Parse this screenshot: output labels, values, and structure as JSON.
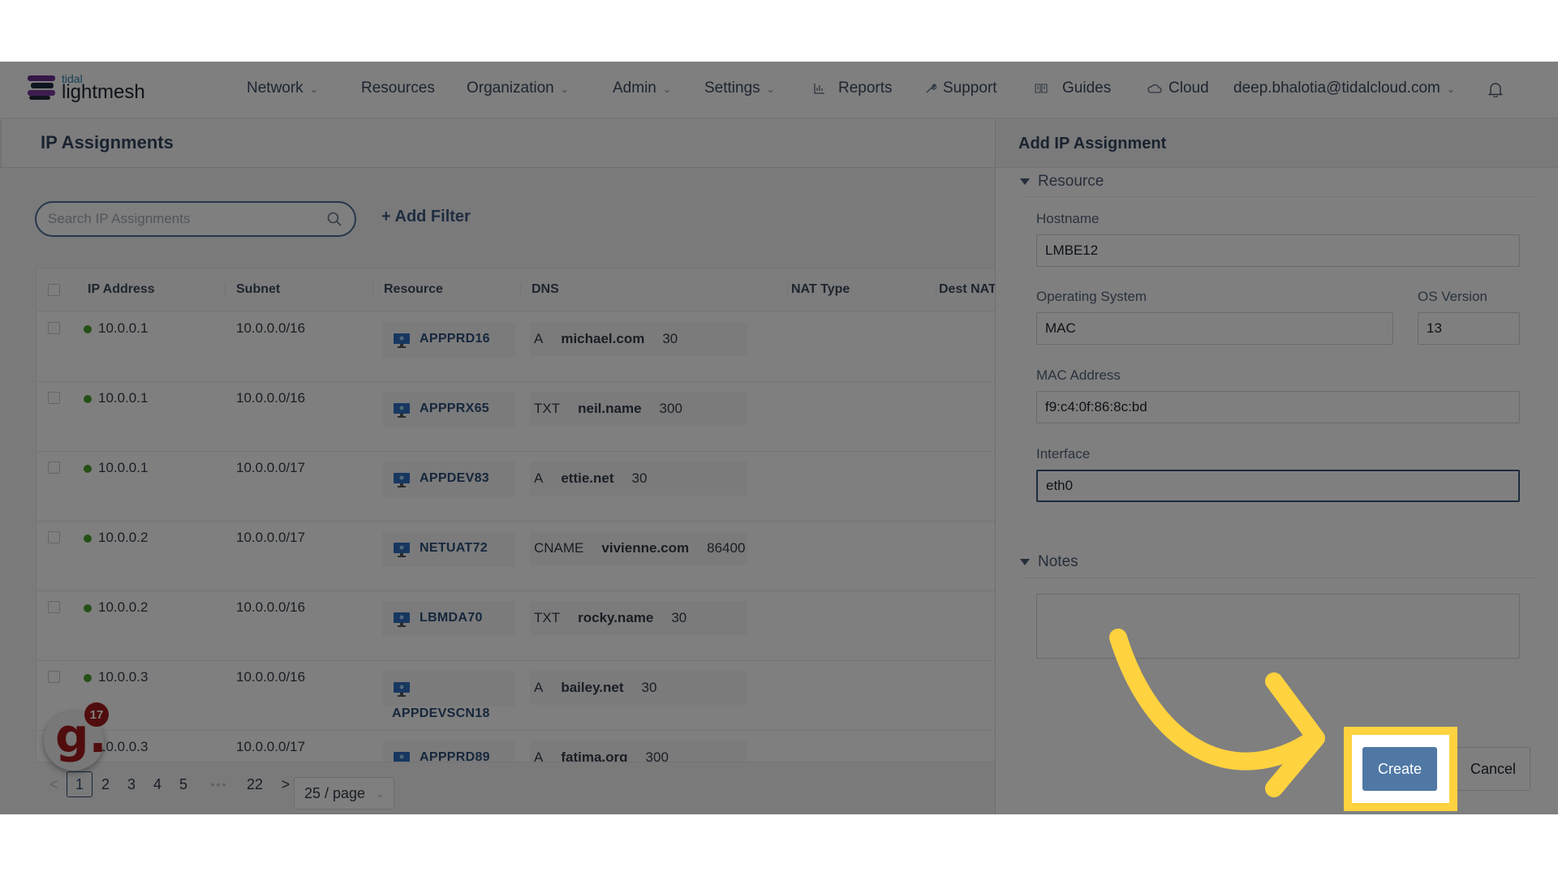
{
  "app": {
    "logo_top": "tidal",
    "logo_bottom": "lightmesh"
  },
  "nav": {
    "items": [
      {
        "label": "Network",
        "dropdown": true,
        "icon": null
      },
      {
        "label": "Resources",
        "dropdown": false,
        "icon": null
      },
      {
        "label": "Organization",
        "dropdown": true,
        "icon": null
      },
      {
        "label": "Admin",
        "dropdown": true,
        "icon": null
      },
      {
        "label": "Settings",
        "dropdown": true,
        "icon": null
      },
      {
        "label": "Reports",
        "dropdown": false,
        "icon": "bar-chart-icon"
      },
      {
        "label": "Support",
        "dropdown": false,
        "icon": "wrench-icon"
      },
      {
        "label": "Guides",
        "dropdown": false,
        "icon": "book-icon"
      },
      {
        "label": "Cloud",
        "dropdown": false,
        "icon": "cloud-icon"
      }
    ],
    "user": "deep.bhalotia@tidalcloud.com",
    "chevron": "⌄",
    "bell_icon": "bell-icon"
  },
  "page": {
    "title": "IP Assignments",
    "search_placeholder": "Search IP Assignments",
    "add_filter": "+ Add Filter"
  },
  "table": {
    "columns": [
      "IP Address",
      "Subnet",
      "Resource",
      "DNS",
      "NAT Type",
      "Dest NAT"
    ],
    "rows": [
      {
        "ip": "10.0.0.1",
        "subnet": "10.0.0.0/16",
        "resource": "APPPRD16",
        "dns_type": "A",
        "dns_name": "michael.com",
        "ttl": "30",
        "status_color": "#4aa02c"
      },
      {
        "ip": "10.0.0.1",
        "subnet": "10.0.0.0/16",
        "resource": "APPPRX65",
        "dns_type": "TXT",
        "dns_name": "neil.name",
        "ttl": "300",
        "status_color": "#4aa02c"
      },
      {
        "ip": "10.0.0.1",
        "subnet": "10.0.0.0/17",
        "resource": "APPDEV83",
        "dns_type": "A",
        "dns_name": "ettie.net",
        "ttl": "30",
        "status_color": "#4aa02c"
      },
      {
        "ip": "10.0.0.2",
        "subnet": "10.0.0.0/17",
        "resource": "NETUAT72",
        "dns_type": "CNAME",
        "dns_name": "vivienne.com",
        "ttl": "86400",
        "status_color": "#4aa02c"
      },
      {
        "ip": "10.0.0.2",
        "subnet": "10.0.0.0/16",
        "resource": "LBMDA70",
        "dns_type": "TXT",
        "dns_name": "rocky.name",
        "ttl": "30",
        "status_color": "#4aa02c"
      },
      {
        "ip": "10.0.0.3",
        "subnet": "10.0.0.0/16",
        "resource": "APPDEVSCN18",
        "dns_type": "A",
        "dns_name": "bailey.net",
        "ttl": "30",
        "status_color": "#4aa02c"
      },
      {
        "ip": "10.0.0.3",
        "subnet": "10.0.0.0/17",
        "resource": "APPPRD89",
        "dns_type": "A",
        "dns_name": "fatima.org",
        "ttl": "300",
        "status_color": "#4aa02c"
      }
    ]
  },
  "pagination": {
    "prev": "<",
    "pages": [
      "1",
      "2",
      "3",
      "4",
      "5"
    ],
    "ellipsis": "•••",
    "last": "22",
    "next": ">",
    "current": "1",
    "page_size": "25 / page"
  },
  "badge": {
    "letter": "g.",
    "count": "17"
  },
  "panel": {
    "title": "Add IP Assignment",
    "section_resource": "Resource",
    "hostname_label": "Hostname",
    "hostname_value": "LMBE12",
    "os_label": "Operating System",
    "os_value": "MAC",
    "os_version_label": "OS Version",
    "os_version_value": "13",
    "mac_label": "MAC Address",
    "mac_value": "f9:c4:0f:86:8c:bd",
    "interface_label": "Interface",
    "interface_value": "eth0",
    "section_notes": "Notes",
    "notes_value": "",
    "create": "Create",
    "cancel": "Cancel"
  },
  "colors": {
    "accent": "#4a74a4",
    "highlight": "#ffd23f",
    "status_active": "#4aa02c",
    "brand_purple": "#7a3a9e"
  }
}
